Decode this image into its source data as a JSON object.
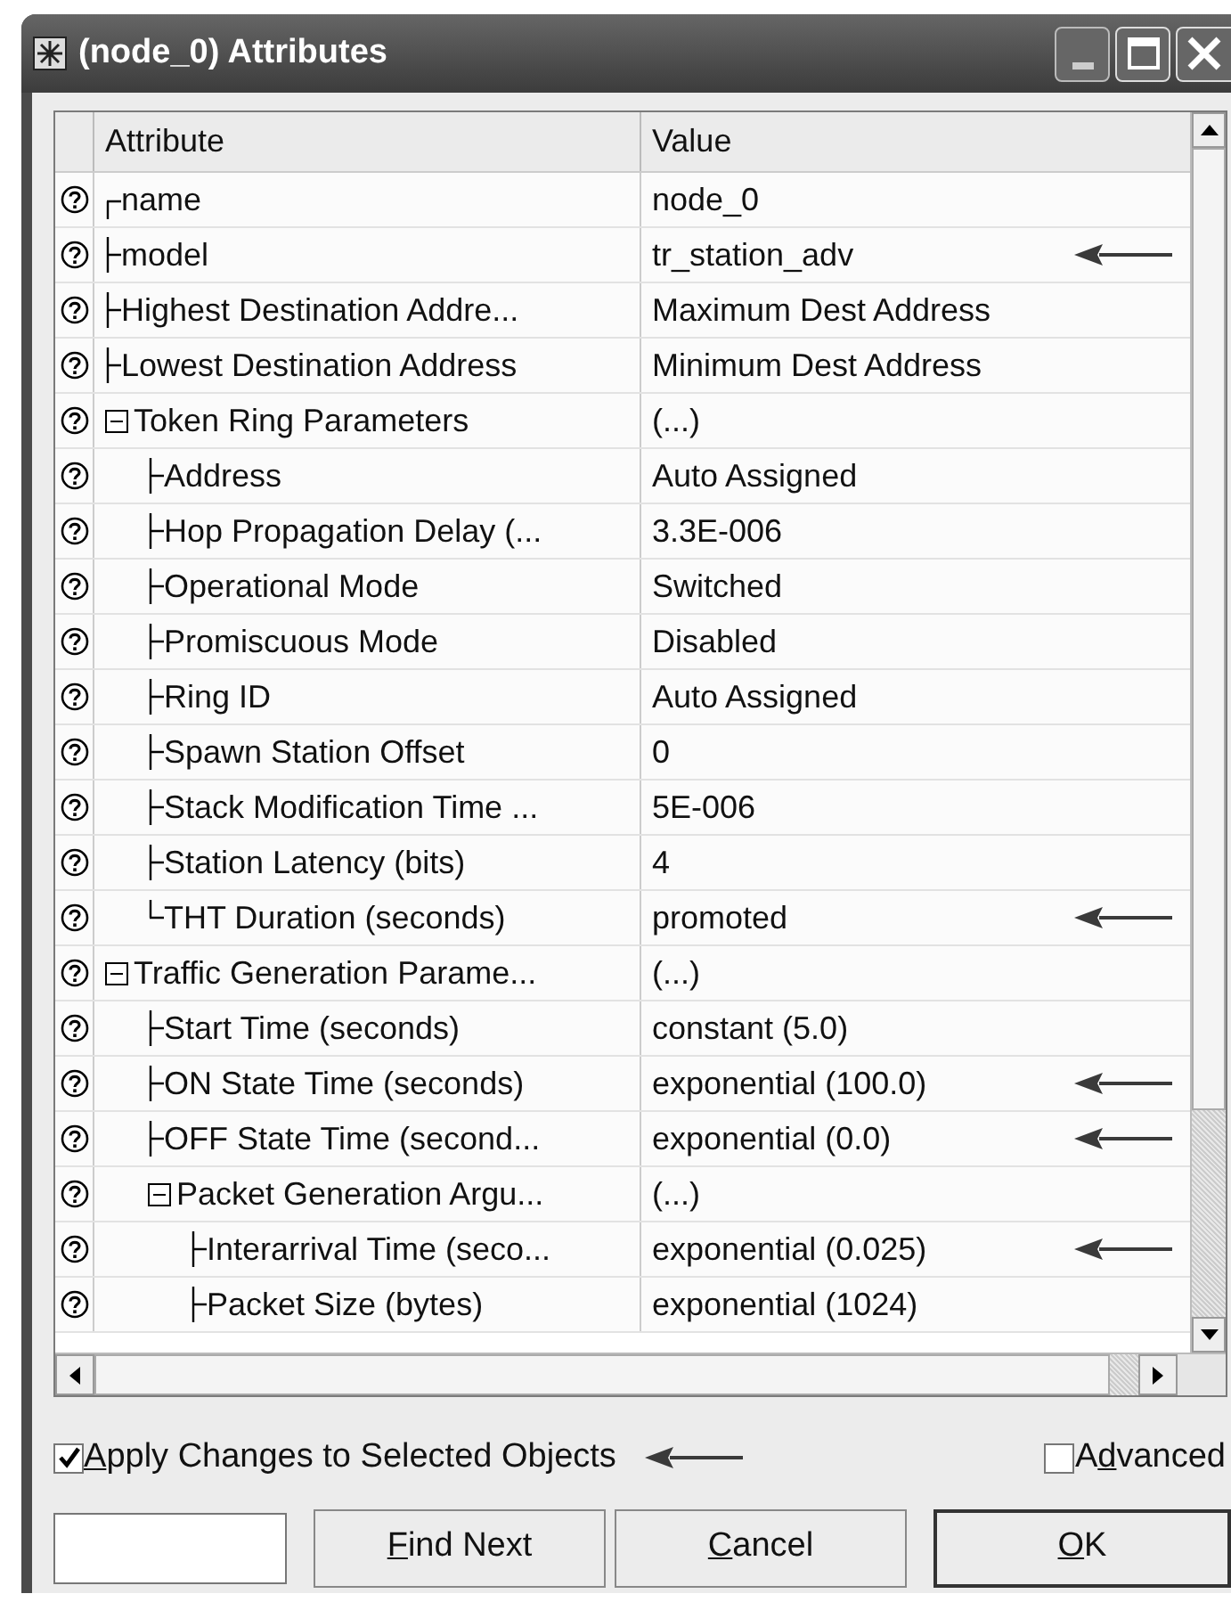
{
  "window": {
    "title": "(node_0) Attributes"
  },
  "table": {
    "columns": [
      "Attribute",
      "Value"
    ],
    "rows": [
      {
        "name": "name",
        "value": "node_0",
        "kind": "first",
        "arrow": false
      },
      {
        "name": "model",
        "value": "tr_station_adv",
        "kind": "middle",
        "arrow": true
      },
      {
        "name": "Highest Destination Addre...",
        "value": "Maximum Dest Address",
        "kind": "middle",
        "arrow": false
      },
      {
        "name": "Lowest Destination Address",
        "value": "Minimum Dest Address",
        "kind": "middle",
        "arrow": false
      },
      {
        "name": "Token Ring Parameters",
        "value": "(...)",
        "kind": "group",
        "expanded": true,
        "arrow": false,
        "children": [
          {
            "name": "Address",
            "value": "Auto Assigned",
            "kind": "middle",
            "arrow": false
          },
          {
            "name": "Hop Propagation Delay (...",
            "value": "3.3E-006",
            "kind": "middle",
            "arrow": false
          },
          {
            "name": "Operational Mode",
            "value": "Switched",
            "kind": "middle",
            "arrow": false
          },
          {
            "name": "Promiscuous Mode",
            "value": "Disabled",
            "kind": "middle",
            "arrow": false
          },
          {
            "name": "Ring ID",
            "value": "Auto Assigned",
            "kind": "middle",
            "arrow": false
          },
          {
            "name": "Spawn Station Offset",
            "value": "0",
            "kind": "middle",
            "arrow": false
          },
          {
            "name": "Stack Modification Time ...",
            "value": "5E-006",
            "kind": "middle",
            "arrow": false
          },
          {
            "name": "Station Latency (bits)",
            "value": "4",
            "kind": "middle",
            "arrow": false
          },
          {
            "name": "THT Duration (seconds)",
            "value": "promoted",
            "kind": "last",
            "arrow": true
          }
        ]
      },
      {
        "name": "Traffic Generation Parame...",
        "value": "(...)",
        "kind": "group",
        "expanded": true,
        "arrow": false,
        "children": [
          {
            "name": "Start Time (seconds)",
            "value": "constant (5.0)",
            "kind": "middle",
            "arrow": false
          },
          {
            "name": "ON State Time (seconds)",
            "value": "exponential (100.0)",
            "kind": "middle",
            "arrow": true
          },
          {
            "name": "OFF State Time (second...",
            "value": "exponential (0.0)",
            "kind": "middle",
            "arrow": true
          },
          {
            "name": "Packet Generation Argu...",
            "value": "(...)",
            "kind": "group",
            "expanded": true,
            "arrow": false,
            "children": [
              {
                "name": "Interarrival Time (seco...",
                "value": "exponential (0.025)",
                "kind": "middle",
                "arrow": true
              },
              {
                "name": "Packet Size (bytes)",
                "value": "exponential (1024)",
                "kind": "middle",
                "arrow": false
              }
            ]
          }
        ]
      }
    ]
  },
  "options": [
    {
      "key": "A",
      "after": "pply Changes to Selected Objects",
      "checked": true,
      "arrow": true
    },
    {
      "before": "A",
      "key": "d",
      "after": "vanced",
      "checked": false,
      "arrow": false
    }
  ],
  "buttons": [
    {
      "key": "F",
      "after": "ind Next",
      "default": false
    },
    {
      "key": "C",
      "after": "ancel",
      "default": false
    },
    {
      "key": "O",
      "after": "K",
      "default": true
    }
  ]
}
